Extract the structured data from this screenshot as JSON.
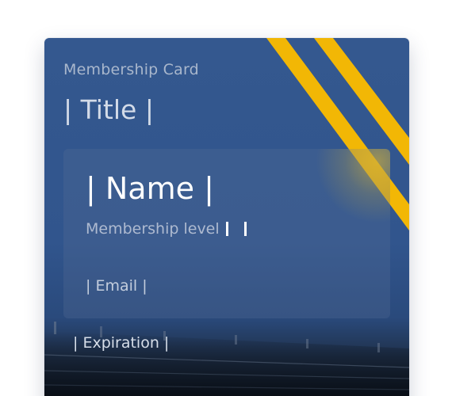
{
  "card": {
    "label": "Membership Card",
    "title": "| Title |",
    "name": "| Name |",
    "membership_level_label": "Membership level",
    "membership_level_value": "",
    "email": "| Email |",
    "expiration": "| Expiration |"
  },
  "colors": {
    "card_blue": "#34588f",
    "stripe_yellow": "#f2b705",
    "panel_overlay": "#566e96",
    "text_muted": "#a9b7cc",
    "text_white": "#ffffff"
  },
  "icons": {
    "stripes": "diagonal-stripes-graphic",
    "background": "stadium-silhouette-image"
  }
}
